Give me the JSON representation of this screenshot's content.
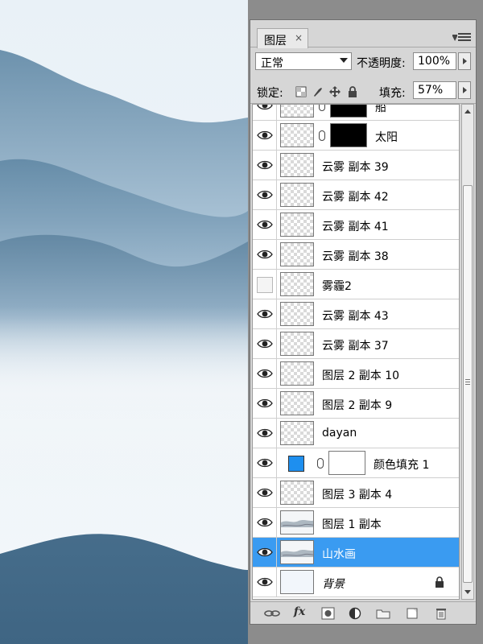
{
  "panel": {
    "tab_label": "图层",
    "tab_close": "×"
  },
  "blend": {
    "mode": "正常",
    "opacity_label": "不透明度:",
    "opacity_value": "100%"
  },
  "lock": {
    "label": "锁定:",
    "fill_label": "填充:",
    "fill_value": "57%"
  },
  "layers": [
    {
      "name": "船",
      "visible": true,
      "thumb": "checker",
      "mask": "half"
    },
    {
      "name": "太阳",
      "visible": true,
      "thumb": "checker",
      "mask": "black"
    },
    {
      "name": "云雾 副本 39",
      "visible": true,
      "thumb": "checker"
    },
    {
      "name": "云雾 副本 42",
      "visible": true,
      "thumb": "checker"
    },
    {
      "name": "云雾 副本 41",
      "visible": true,
      "thumb": "checker"
    },
    {
      "name": "云雾 副本 38",
      "visible": true,
      "thumb": "checker"
    },
    {
      "name": "雾霾2",
      "visible": false,
      "thumb": "checker"
    },
    {
      "name": "云雾 副本 43",
      "visible": true,
      "thumb": "checker"
    },
    {
      "name": "云雾 副本 37",
      "visible": true,
      "thumb": "checker"
    },
    {
      "name": "图层 2 副本 10",
      "visible": true,
      "thumb": "checker"
    },
    {
      "name": "图层 2 副本 9",
      "visible": true,
      "thumb": "checker"
    },
    {
      "name": "dayan",
      "visible": true,
      "thumb": "checker"
    },
    {
      "name": "颜色填充 1",
      "visible": true,
      "thumb": "fill",
      "mask": "white",
      "fill_color": "#1e8fef"
    },
    {
      "name": "图层 3 副本 4",
      "visible": true,
      "thumb": "checker"
    },
    {
      "name": "图层 1 副本",
      "visible": true,
      "thumb": "ink"
    },
    {
      "name": "山水画",
      "visible": true,
      "thumb": "ink",
      "selected": true
    },
    {
      "name": "背景",
      "visible": true,
      "thumb": "plain",
      "locked": true
    }
  ],
  "toolbar": {
    "link_icon": "link-layers-icon",
    "fx_label": "fx",
    "mask_icon": "add-mask-icon",
    "adjust_icon": "adjustment-layer-icon",
    "group_icon": "new-group-icon",
    "new_icon": "new-layer-icon",
    "delete_icon": "trash-icon"
  },
  "colors": {
    "selection": "#3a9bf1",
    "panel_bg": "#d6d6d6",
    "canvas_sky": "#eef4f9",
    "mountain_dark": "#4f7896"
  }
}
